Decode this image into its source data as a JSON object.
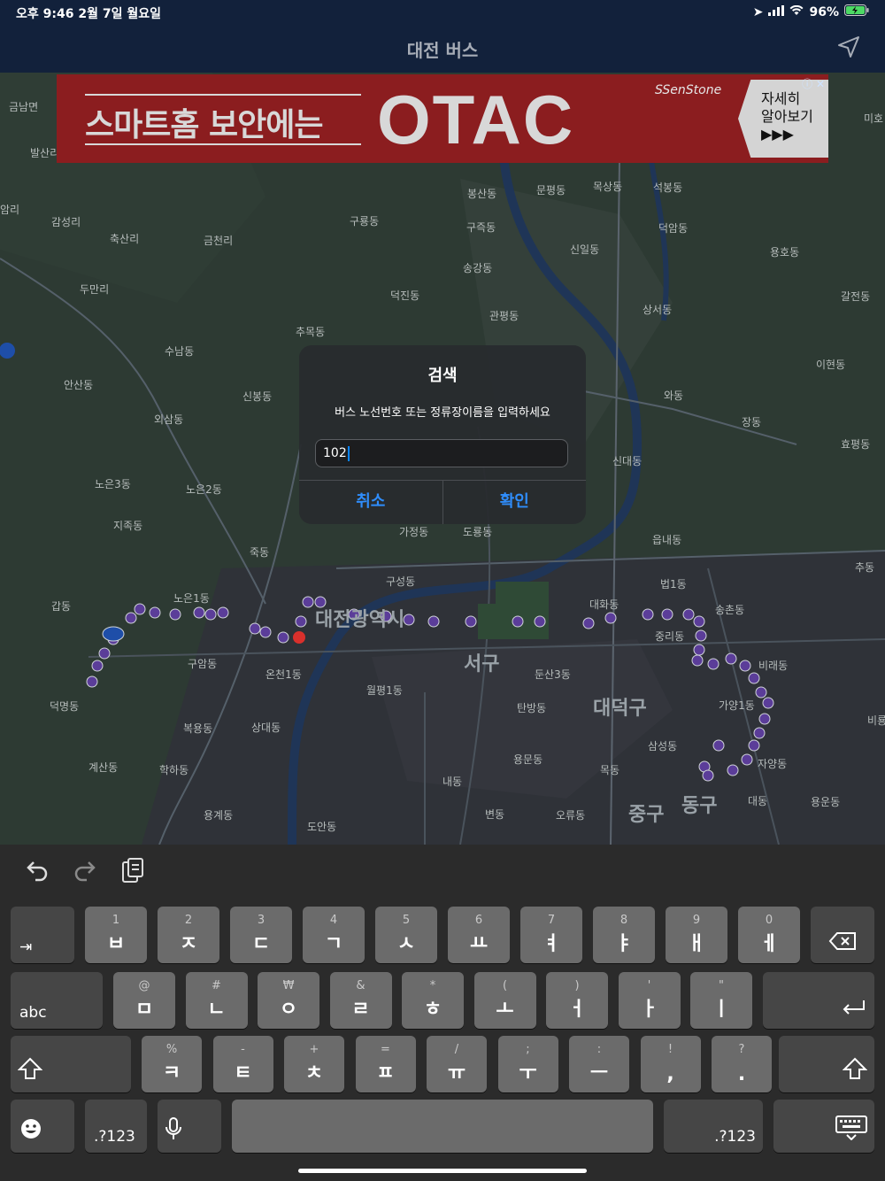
{
  "status_bar": {
    "time_date": "오후 9:46   2월 7일 월요일",
    "battery": "96%"
  },
  "nav": {
    "title": "대전 버스"
  },
  "ad": {
    "slogan": "스마트홈 보안에는",
    "brand": "OTAC",
    "sponsor": "SSenStone",
    "more_line1": "자세히",
    "more_line2": "알아보기",
    "more_arrows": "▶▶▶",
    "info": "ⓘ ✕"
  },
  "map": {
    "labels": [
      {
        "text": "금남면"
      },
      {
        "text": "발산리"
      },
      {
        "text": "암리"
      },
      {
        "text": "감성리"
      },
      {
        "text": "축산리"
      },
      {
        "text": "금천리"
      },
      {
        "text": "구룡동"
      },
      {
        "text": "봉산동"
      },
      {
        "text": "문평동"
      },
      {
        "text": "목상동"
      },
      {
        "text": "석봉동"
      },
      {
        "text": "구즉동"
      },
      {
        "text": "덕암동"
      },
      {
        "text": "신일동"
      },
      {
        "text": "용호동"
      },
      {
        "text": "두만리"
      },
      {
        "text": "송강동"
      },
      {
        "text": "덕진동"
      },
      {
        "text": "관평동"
      },
      {
        "text": "갈전동"
      },
      {
        "text": "추목동"
      },
      {
        "text": "상서동"
      },
      {
        "text": "수남동"
      },
      {
        "text": "이현동"
      },
      {
        "text": "안산동"
      },
      {
        "text": "신봉동"
      },
      {
        "text": "와동"
      },
      {
        "text": "외삼동"
      },
      {
        "text": "장동"
      },
      {
        "text": "효평동"
      },
      {
        "text": "신대동"
      },
      {
        "text": "노은3동"
      },
      {
        "text": "노은2동"
      },
      {
        "text": "지족동"
      },
      {
        "text": "가정동"
      },
      {
        "text": "도룡동"
      },
      {
        "text": "읍내동"
      },
      {
        "text": "죽동"
      },
      {
        "text": "추동"
      },
      {
        "text": "구성동"
      },
      {
        "text": "법1동"
      },
      {
        "text": "노은1동"
      },
      {
        "text": "갑동"
      },
      {
        "text": "대화동"
      },
      {
        "text": "송촌동"
      },
      {
        "text": "대전광역시"
      },
      {
        "text": "서구"
      },
      {
        "text": "구암동"
      },
      {
        "text": "온천1동"
      },
      {
        "text": "중리동"
      },
      {
        "text": "비래동"
      },
      {
        "text": "덕명동"
      },
      {
        "text": "월평1동"
      },
      {
        "text": "둔산3동"
      },
      {
        "text": "탄방동"
      },
      {
        "text": "대덕구"
      },
      {
        "text": "가양1동"
      },
      {
        "text": "복용동"
      },
      {
        "text": "상대동"
      },
      {
        "text": "삼성동"
      },
      {
        "text": "계산동"
      },
      {
        "text": "학하동"
      },
      {
        "text": "용문동"
      },
      {
        "text": "목동"
      },
      {
        "text": "자양동"
      },
      {
        "text": "내동"
      },
      {
        "text": "용계동"
      },
      {
        "text": "변동"
      },
      {
        "text": "오류동"
      },
      {
        "text": "중구"
      },
      {
        "text": "동구"
      },
      {
        "text": "대동"
      },
      {
        "text": "용운동"
      },
      {
        "text": "도안동"
      },
      {
        "text": "미호"
      },
      {
        "text": "비룡"
      }
    ]
  },
  "dialog": {
    "title": "검색",
    "message": "버스 노선번호 또는 정류장이름을 입력하세요",
    "input_value": "102",
    "cancel": "취소",
    "confirm": "확인"
  },
  "keyboard": {
    "row1": [
      {
        "sub": "1",
        "main": "ㅂ"
      },
      {
        "sub": "2",
        "main": "ㅈ"
      },
      {
        "sub": "3",
        "main": "ㄷ"
      },
      {
        "sub": "4",
        "main": "ㄱ"
      },
      {
        "sub": "5",
        "main": "ㅅ"
      },
      {
        "sub": "6",
        "main": "ㅛ"
      },
      {
        "sub": "7",
        "main": "ㅕ"
      },
      {
        "sub": "8",
        "main": "ㅑ"
      },
      {
        "sub": "9",
        "main": "ㅐ"
      },
      {
        "sub": "0",
        "main": "ㅔ"
      }
    ],
    "row2": [
      {
        "sub": "@",
        "main": "ㅁ"
      },
      {
        "sub": "#",
        "main": "ㄴ"
      },
      {
        "sub": "₩",
        "main": "ㅇ"
      },
      {
        "sub": "&",
        "main": "ㄹ"
      },
      {
        "sub": "*",
        "main": "ㅎ"
      },
      {
        "sub": "(",
        "main": "ㅗ"
      },
      {
        "sub": ")",
        "main": "ㅓ"
      },
      {
        "sub": "'",
        "main": "ㅏ"
      },
      {
        "sub": "\"",
        "main": "ㅣ"
      }
    ],
    "row3": [
      {
        "sub": "%",
        "main": "ㅋ"
      },
      {
        "sub": "-",
        "main": "ㅌ"
      },
      {
        "sub": "+",
        "main": "ㅊ"
      },
      {
        "sub": "=",
        "main": "ㅍ"
      },
      {
        "sub": "/",
        "main": "ㅠ"
      },
      {
        "sub": ";",
        "main": "ㅜ"
      },
      {
        "sub": ":",
        "main": "ㅡ"
      },
      {
        "sub": "!",
        "main": ","
      },
      {
        "sub": "?",
        "main": "."
      }
    ],
    "abc": "abc",
    "numbers": ".?123"
  }
}
